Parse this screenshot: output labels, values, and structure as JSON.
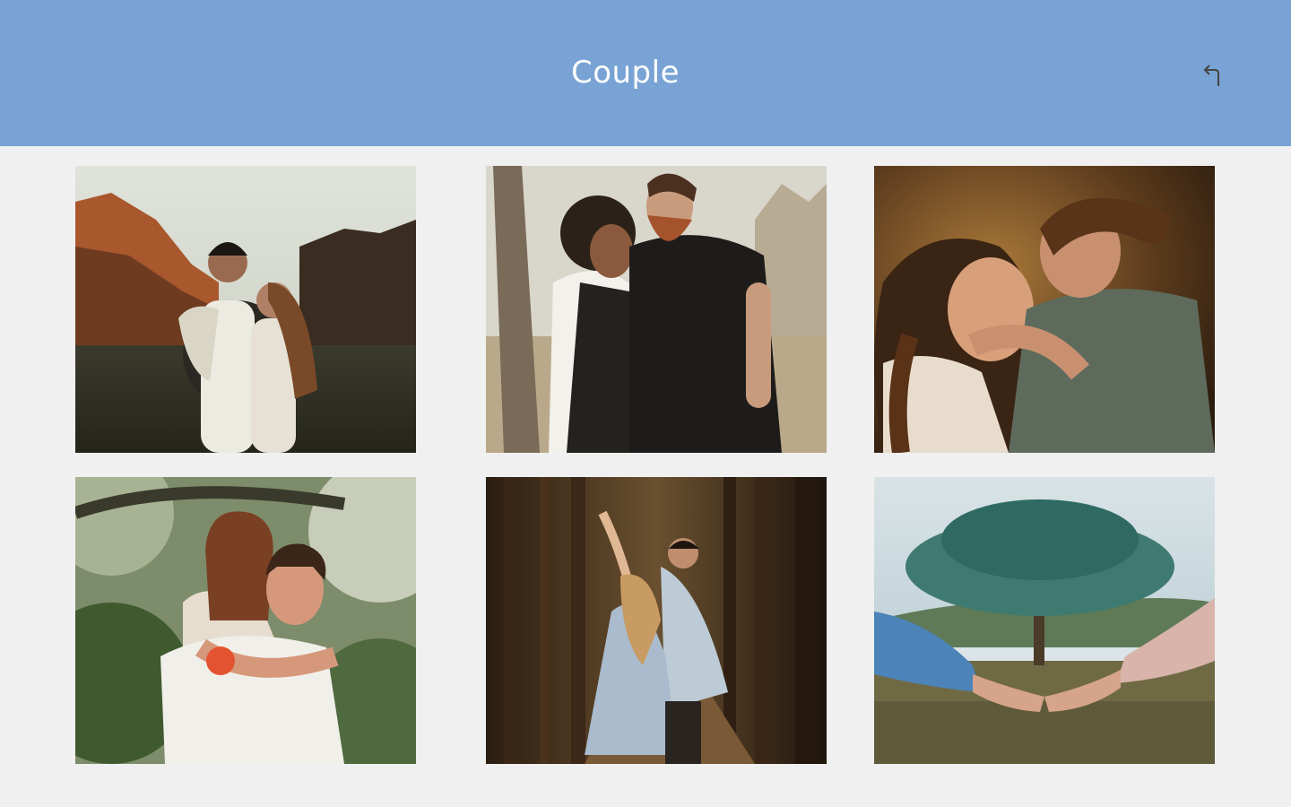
{
  "header": {
    "title": "Couple",
    "back_icon": "back-arrow-icon",
    "background_color": "#78a3d4",
    "title_color": "#ffffff"
  },
  "gallery": {
    "background_color": "#f0f0f0",
    "photos": [
      {
        "subject": "couple-in-canyon"
      },
      {
        "subject": "couple-forehead-kiss"
      },
      {
        "subject": "couple-kiss-sunset"
      },
      {
        "subject": "couple-piggyback"
      },
      {
        "subject": "couple-dancing-forest"
      },
      {
        "subject": "holding-hands-tree"
      }
    ]
  }
}
